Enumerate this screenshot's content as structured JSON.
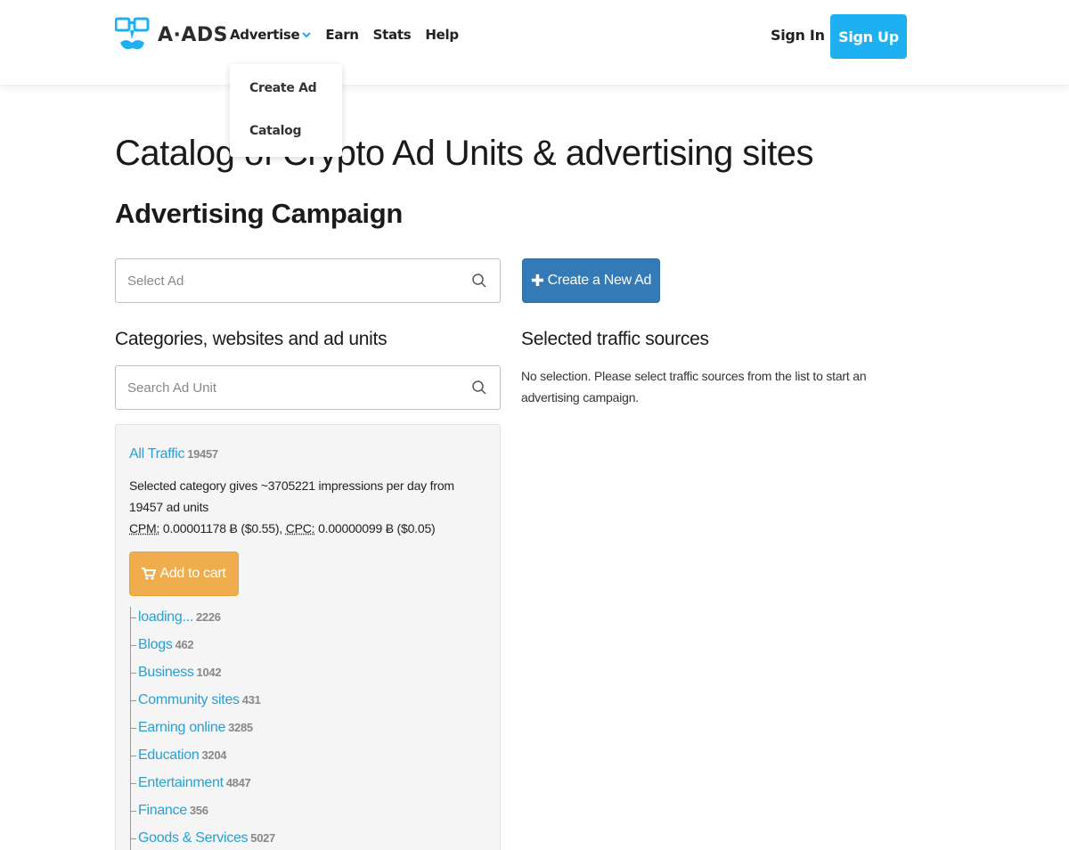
{
  "header": {
    "logo_text": "A·ADS",
    "nav": [
      {
        "label": "Advertise",
        "has_dropdown": true
      },
      {
        "label": "Earn"
      },
      {
        "label": "Stats"
      },
      {
        "label": "Help"
      }
    ],
    "signin_label": "Sign In",
    "signup_label": "Sign Up",
    "accent_color": "#1fb0f2"
  },
  "dropdown": {
    "items": [
      "Create Ad",
      "Catalog"
    ]
  },
  "page": {
    "title": "Catalog of Crypto Ad Units & advertising sites",
    "subtitle": "Advertising Campaign"
  },
  "select_ad": {
    "placeholder": "Select Ad",
    "value": ""
  },
  "create_button": {
    "icon": "plus-icon",
    "label": "Create a New Ad"
  },
  "categories": {
    "heading": "Categories, websites and ad units",
    "search_placeholder": "Search Ad Unit",
    "all_traffic": {
      "label": "All Traffic",
      "count": "19457"
    },
    "info_line1": "Selected category gives ~3705221 impressions per day from 19457 ad units",
    "cpm_label": "CPM:",
    "cpm_value": "0.00001178 Ƀ ($0.55),",
    "cpc_label": "CPC:",
    "cpc_value": "0.00000099 Ƀ ($0.05)",
    "cart_button": "Add to cart",
    "items": [
      {
        "label": "loading...",
        "count": "2226"
      },
      {
        "label": "Blogs",
        "count": "462"
      },
      {
        "label": "Business",
        "count": "1042"
      },
      {
        "label": "Community sites",
        "count": "431"
      },
      {
        "label": "Earning online",
        "count": "3285"
      },
      {
        "label": "Education",
        "count": "3204"
      },
      {
        "label": "Entertainment",
        "count": "4847"
      },
      {
        "label": "Finance",
        "count": "356"
      },
      {
        "label": "Goods & Services",
        "count": "5027"
      }
    ]
  },
  "traffic_sources": {
    "heading": "Selected traffic sources",
    "empty_text": "No selection. Please select traffic sources from the list to start an advertising campaign."
  }
}
